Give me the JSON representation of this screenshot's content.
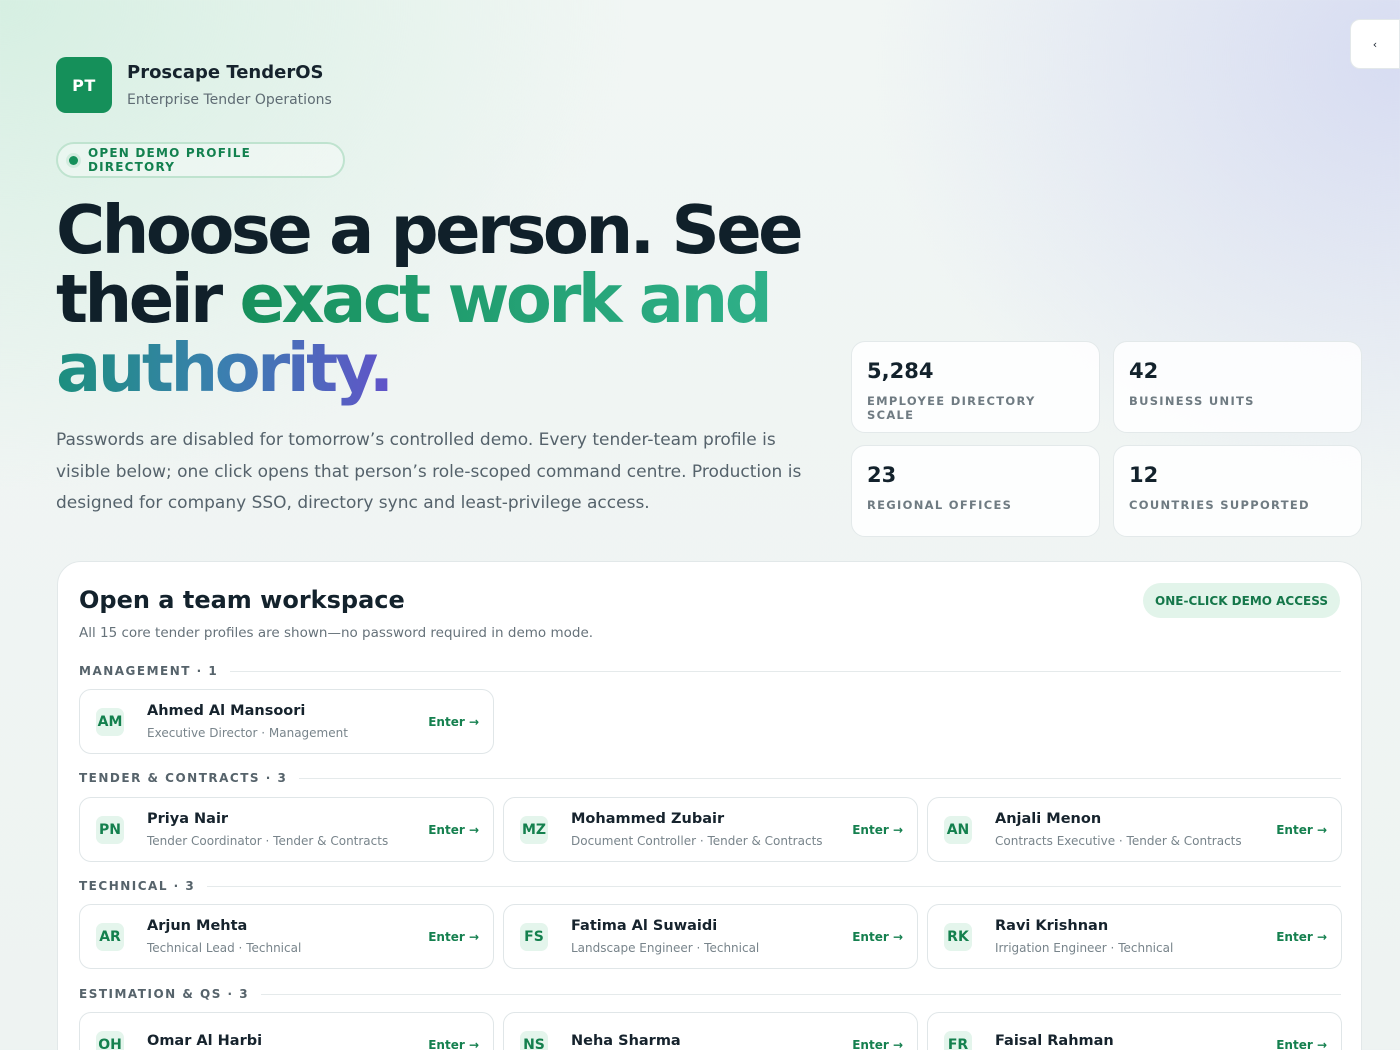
{
  "brand": {
    "logo": "PT",
    "name": "Proscape TenderOS",
    "subtitle": "Enterprise Tender Operations"
  },
  "collapse_icon": "‹",
  "pill": "OPEN DEMO PROFILE DIRECTORY",
  "headline": {
    "part1": "Choose a person. See their ",
    "part2": "exact work and",
    "part3": "authority."
  },
  "intro": "Passwords are disabled for tomorrow’s controlled demo. Every tender-team profile is visible below; one click opens that person’s role-scoped command centre. Production is designed for company SSO, directory sync and least-privilege access.",
  "stats": [
    {
      "value": "5,284",
      "label": "EMPLOYEE DIRECTORY SCALE"
    },
    {
      "value": "42",
      "label": "BUSINESS UNITS"
    },
    {
      "value": "23",
      "label": "REGIONAL OFFICES"
    },
    {
      "value": "12",
      "label": "COUNTRIES SUPPORTED"
    }
  ],
  "panel": {
    "title": "Open a team workspace",
    "subtitle": "All 15 core tender profiles are shown—no password required in demo mode.",
    "badge": "ONE-CLICK DEMO ACCESS",
    "enter_label": "Enter →",
    "groups": [
      {
        "heading": "MANAGEMENT · 1",
        "people": [
          {
            "initials": "AM",
            "name": "Ahmed Al Mansoori",
            "role": "Executive Director · Management"
          }
        ]
      },
      {
        "heading": "TENDER & CONTRACTS · 3",
        "people": [
          {
            "initials": "PN",
            "name": "Priya Nair",
            "role": "Tender Coordinator · Tender & Contracts"
          },
          {
            "initials": "MZ",
            "name": "Mohammed Zubair",
            "role": "Document Controller · Tender & Contracts"
          },
          {
            "initials": "AN",
            "name": "Anjali Menon",
            "role": "Contracts Executive · Tender & Contracts"
          }
        ]
      },
      {
        "heading": "TECHNICAL · 3",
        "people": [
          {
            "initials": "AR",
            "name": "Arjun Mehta",
            "role": "Technical Lead · Technical"
          },
          {
            "initials": "FS",
            "name": "Fatima Al Suwaidi",
            "role": "Landscape Engineer · Technical"
          },
          {
            "initials": "RK",
            "name": "Ravi Krishnan",
            "role": "Irrigation Engineer · Technical"
          }
        ]
      },
      {
        "heading": "ESTIMATION & QS · 3",
        "people": [
          {
            "initials": "OH",
            "name": "Omar Al Harbi",
            "role": ""
          },
          {
            "initials": "NS",
            "name": "Neha Sharma",
            "role": ""
          },
          {
            "initials": "FR",
            "name": "Faisal Rahman",
            "role": ""
          }
        ]
      }
    ]
  }
}
